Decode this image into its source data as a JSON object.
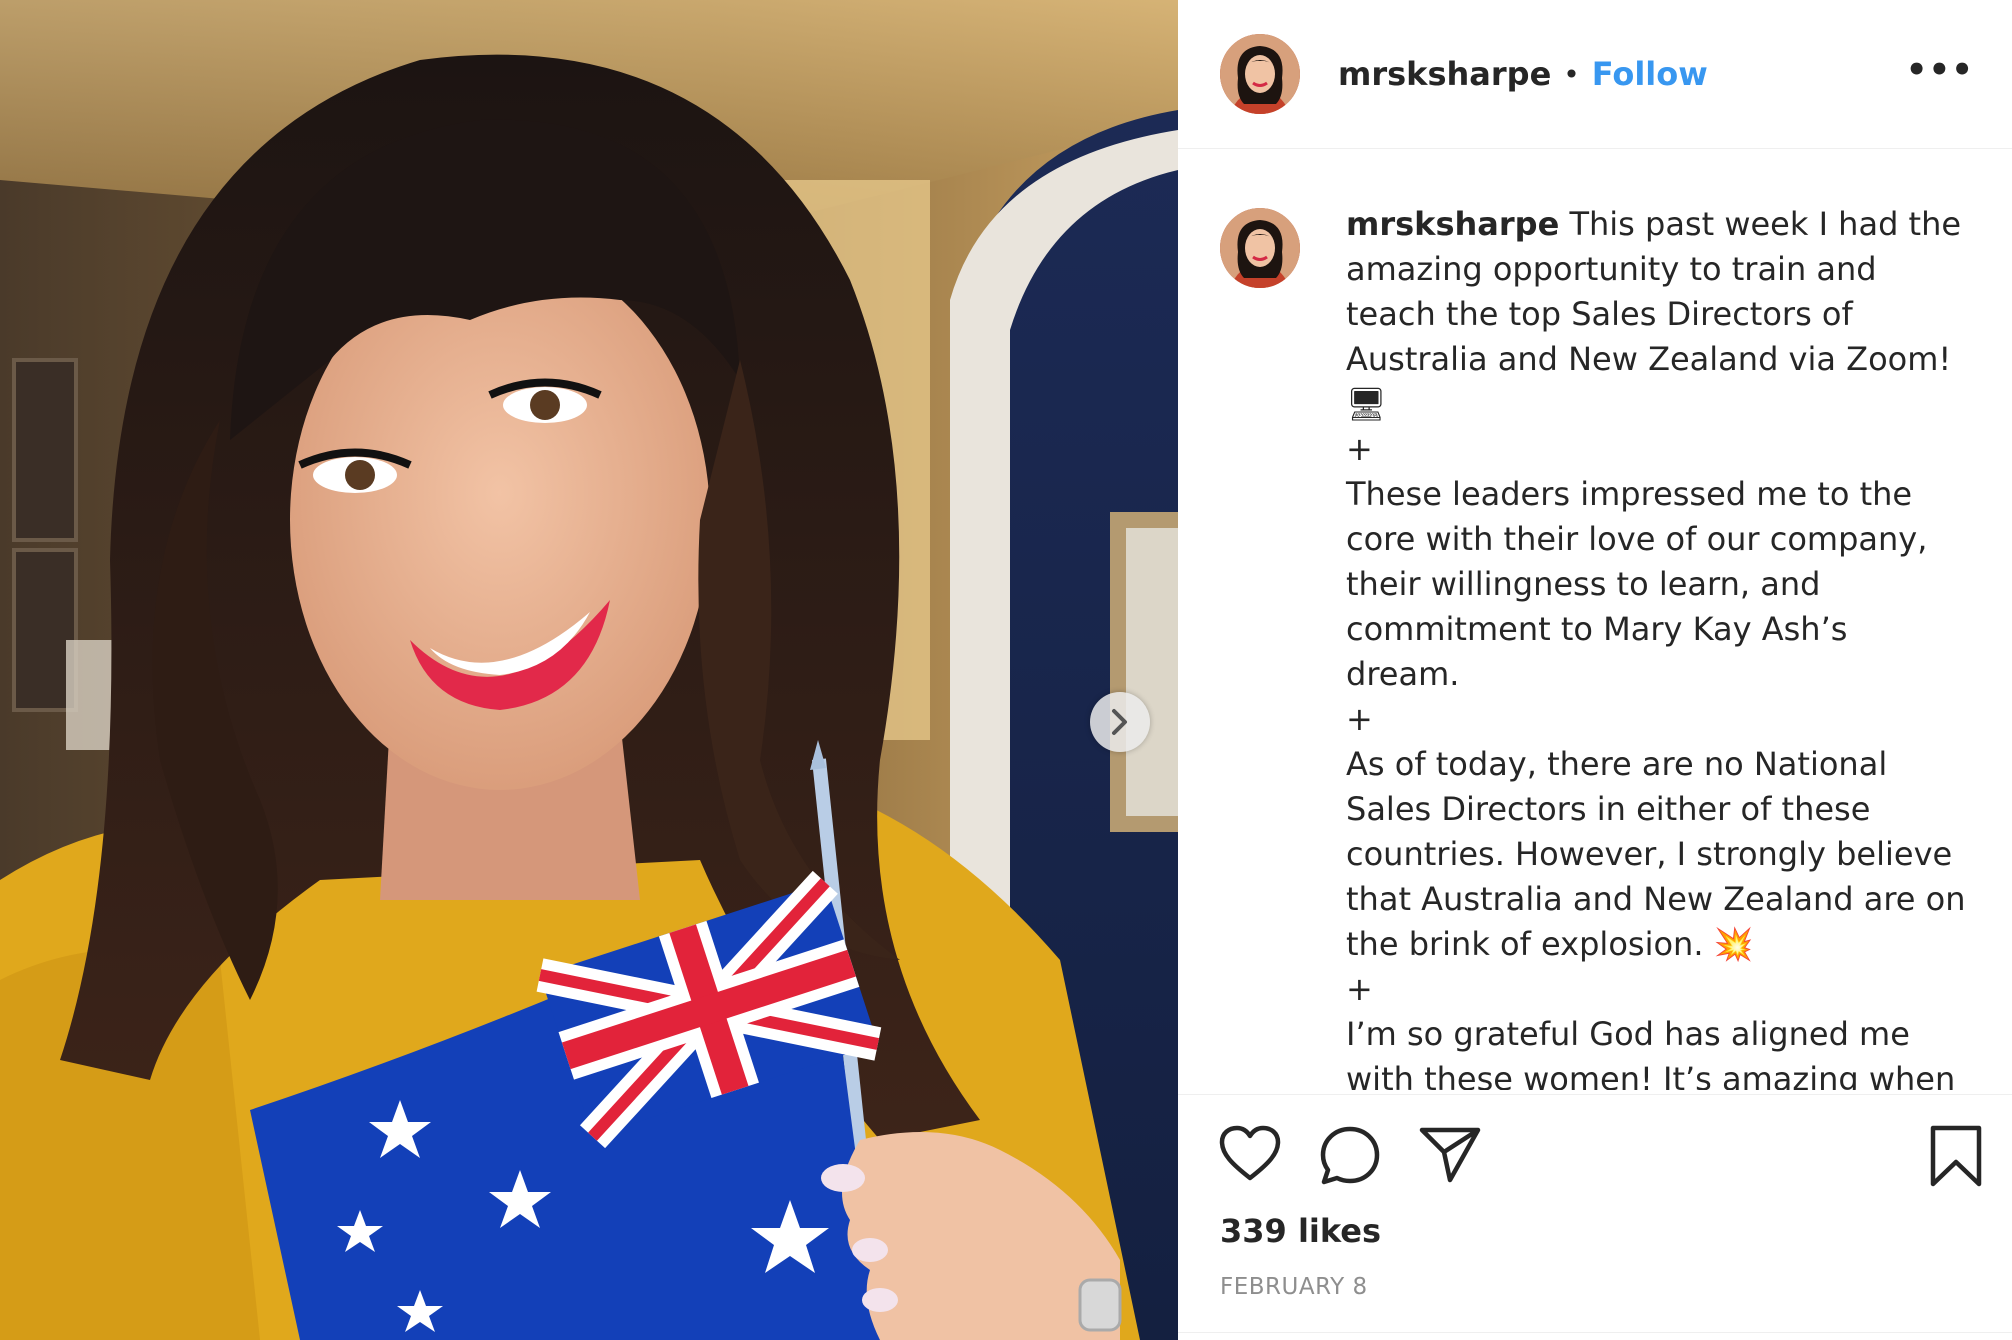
{
  "header": {
    "username": "mrsksharpe",
    "separator": "•",
    "follow_label": "Follow",
    "more_label": "•••",
    "avatar_icon": "profile-avatar"
  },
  "photo": {
    "subject": "selfie-with-australian-flag",
    "next_icon": "chevron-right-icon"
  },
  "caption": {
    "username": "mrsksharpe",
    "text": " This past week I had the amazing opportunity to train and teach the top Sales Directors of Australia and New Zealand via Zoom! 🖥\n+\nThese leaders impressed me to the core with their love of our company, their willingness to learn, and commitment to Mary Kay Ash’s dream.\n+\nAs of today, there are no National Sales Directors in either of these countries. However, I strongly believe that Australia and New Zealand are on the brink of explosion. 💥\n+\nI’m so grateful God has aligned me with these women! It’s amazing when"
  },
  "actions": {
    "like_icon": "heart-icon",
    "comment_icon": "comment-icon",
    "share_icon": "paper-plane-icon",
    "save_icon": "bookmark-icon"
  },
  "likes_text": "339 likes",
  "date_text": "FEBRUARY 8",
  "colors": {
    "follow": "#3897f0",
    "text": "#262626",
    "muted": "#8e8e8e",
    "divider": "#efefef"
  }
}
